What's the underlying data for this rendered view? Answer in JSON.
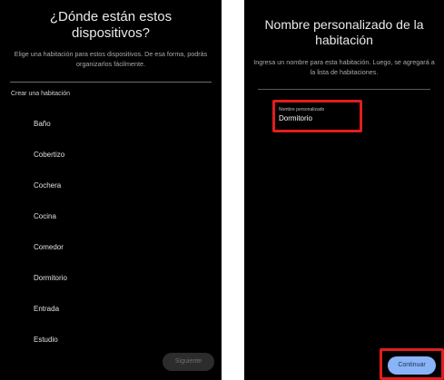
{
  "left_screen": {
    "title": "¿Dónde están estos dispositivos?",
    "subtitle": "Elige una habitación para estos dispositivos. De esa forma, podrás organizarlos fácilmente.",
    "section_label": "Crear una habitación",
    "rooms": [
      "Baño",
      "Cobertizo",
      "Cochera",
      "Cocina",
      "Comedor",
      "Dormitorio",
      "Entrada",
      "Estudio"
    ],
    "next_button_label": "Siguiente"
  },
  "right_screen": {
    "title": "Nombre personalizado de la habitación",
    "subtitle": "Ingresa un nombre para esta habitación. Luego, se agregará a la lista de habitaciones.",
    "input_label": "Nombre personalizado",
    "input_value": "Dormitorio",
    "continue_button_label": "Continuar"
  },
  "colors": {
    "screen_background": "#000000",
    "highlight": "#e21d1d",
    "primary_button": "#8ab4f8",
    "disabled_button": "#2c2c2c"
  }
}
